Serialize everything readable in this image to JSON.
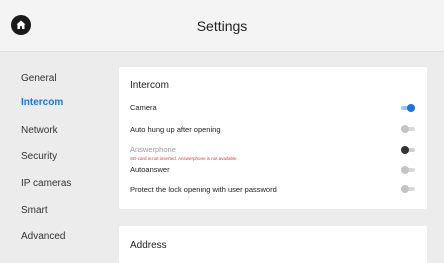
{
  "header": {
    "title": "Settings",
    "home_icon": "home-icon"
  },
  "sidebar": {
    "items": [
      {
        "label": "General",
        "active": false
      },
      {
        "label": "Intercom",
        "active": true
      },
      {
        "label": "Network",
        "active": false
      },
      {
        "label": "Security",
        "active": false
      },
      {
        "label": "IP cameras",
        "active": false
      },
      {
        "label": "Smart",
        "active": false
      },
      {
        "label": "Advanced",
        "active": false
      }
    ]
  },
  "intercom": {
    "title": "Intercom",
    "rows": [
      {
        "label": "Camera",
        "state": "on"
      },
      {
        "label": "Auto hung up after opening",
        "state": "off"
      },
      {
        "label": "Answerphone",
        "state": "off",
        "disabled": true,
        "error": "SD-card is not inserted. Answerphone is not available"
      },
      {
        "label": "Autoanswer",
        "state": "off"
      },
      {
        "label": "Protect the lock opening with user password",
        "state": "off"
      }
    ]
  },
  "address": {
    "title": "Address"
  },
  "colors": {
    "accent": "#1a73e8",
    "error": "#e53935",
    "background": "#ececec",
    "card": "#ffffff"
  }
}
